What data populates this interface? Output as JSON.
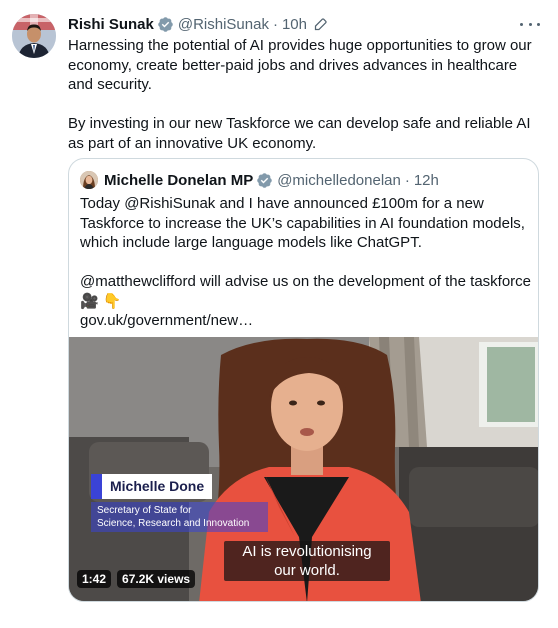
{
  "tweet": {
    "author_name": "Rishi Sunak",
    "handle": "@RishiSunak",
    "separator": "·",
    "time": "10h",
    "paragraphs": [
      "Harnessing the potential of AI provides huge opportunities to grow our economy, create better-paid jobs and drives advances in healthcare and security.",
      "By investing in our new Taskforce we can develop safe and reliable AI as part of an innovative UK economy."
    ]
  },
  "quoted": {
    "author_name": "Michelle Donelan MP",
    "handle": "@michelledonelan",
    "separator": "·",
    "time": "12h",
    "paragraphs": [
      "Today @RishiSunak and I have announced £100m for a new Taskforce to increase the UK’s capabilities in AI foundation models, which include large language models like ChatGPT.",
      "@matthewclifford will advise us on the development of the taskforce"
    ],
    "emojis": [
      "🎥",
      "👇"
    ],
    "link_text": "gov.uk/government/new…"
  },
  "video": {
    "lower_third_name": "Michelle Done",
    "lower_third_title_1": "Secretary of State for",
    "lower_third_title_2": "Science, Research and Innovation",
    "caption_line_1": "AI is revolutionising",
    "caption_line_2": "our world.",
    "duration": "1:42",
    "views": "67.2K views"
  },
  "icons": {
    "verified": "verified-badge-icon",
    "edited": "edited-pencil-icon",
    "more": "more-options-icon"
  },
  "colors": {
    "verified_gold_grey": "#829aab",
    "text_secondary": "#536471",
    "border": "#cfd9de",
    "lower_third_accent": "#3a43d6"
  }
}
